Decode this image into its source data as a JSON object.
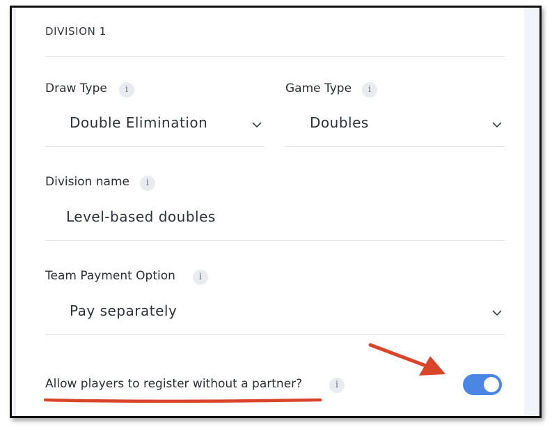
{
  "division": {
    "title": "DIVISION 1"
  },
  "draw_type": {
    "label": "Draw Type",
    "value": "Double Elimination"
  },
  "game_type": {
    "label": "Game Type",
    "value": "Doubles"
  },
  "division_name": {
    "label": "Division name",
    "value": "Level-based doubles"
  },
  "team_payment": {
    "label": "Team Payment Option",
    "value": "Pay separately"
  },
  "allow_no_partner": {
    "label": "Allow players to register without a partner?",
    "enabled": true
  },
  "icons": {
    "info": "i"
  },
  "colors": {
    "toggle_on": "#4b86e4",
    "annotation": "#d9452b"
  }
}
